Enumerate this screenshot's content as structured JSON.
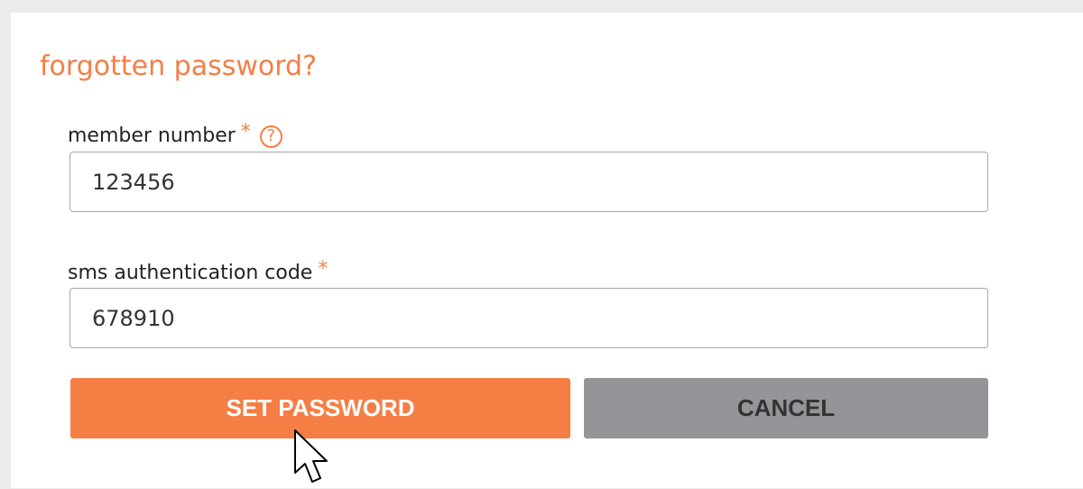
{
  "form": {
    "title": "forgotten password?",
    "member_number": {
      "label": "member number",
      "required_mark": "*",
      "help_glyph": "?",
      "value": "123456"
    },
    "sms_code": {
      "label": "sms authentication code",
      "required_mark": "*",
      "value": "678910"
    },
    "buttons": {
      "submit_label": "SET PASSWORD",
      "cancel_label": "CANCEL"
    }
  },
  "colors": {
    "accent": "#f57e45",
    "cancel_bg": "#939598",
    "page_bg": "#ebebeb",
    "card_bg": "#ffffff"
  },
  "icons": {
    "help": "question-circle-icon",
    "cursor": "mouse-pointer-icon"
  }
}
